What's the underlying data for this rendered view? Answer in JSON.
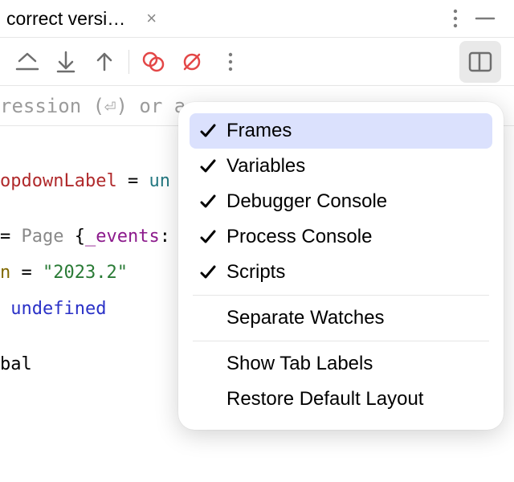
{
  "tab": {
    "title": "correct versi…"
  },
  "expression": {
    "placeholder": "ression (⏎) or a"
  },
  "code": {
    "row1_field": "opdownLabel",
    "row1_eq": " = ",
    "row1_val": "un",
    "row2_eq": "= ",
    "row2_class": "Page",
    "row2_brace": " {",
    "row2_field": "_events",
    "row2_after": ": O",
    "row3_field": "n",
    "row3_eq": " = ",
    "row3_val": "\"2023.2\"",
    "row4_val": "undefined",
    "row5_val": "bal"
  },
  "popup": {
    "items": [
      {
        "label": "Frames",
        "checked": true,
        "highlight": true
      },
      {
        "label": "Variables",
        "checked": true
      },
      {
        "label": "Debugger Console",
        "checked": true
      },
      {
        "label": "Process Console",
        "checked": true
      },
      {
        "label": "Scripts",
        "checked": true
      }
    ],
    "group2": [
      {
        "label": "Separate Watches"
      }
    ],
    "group3": [
      {
        "label": "Show Tab Labels"
      },
      {
        "label": "Restore Default Layout"
      }
    ]
  }
}
